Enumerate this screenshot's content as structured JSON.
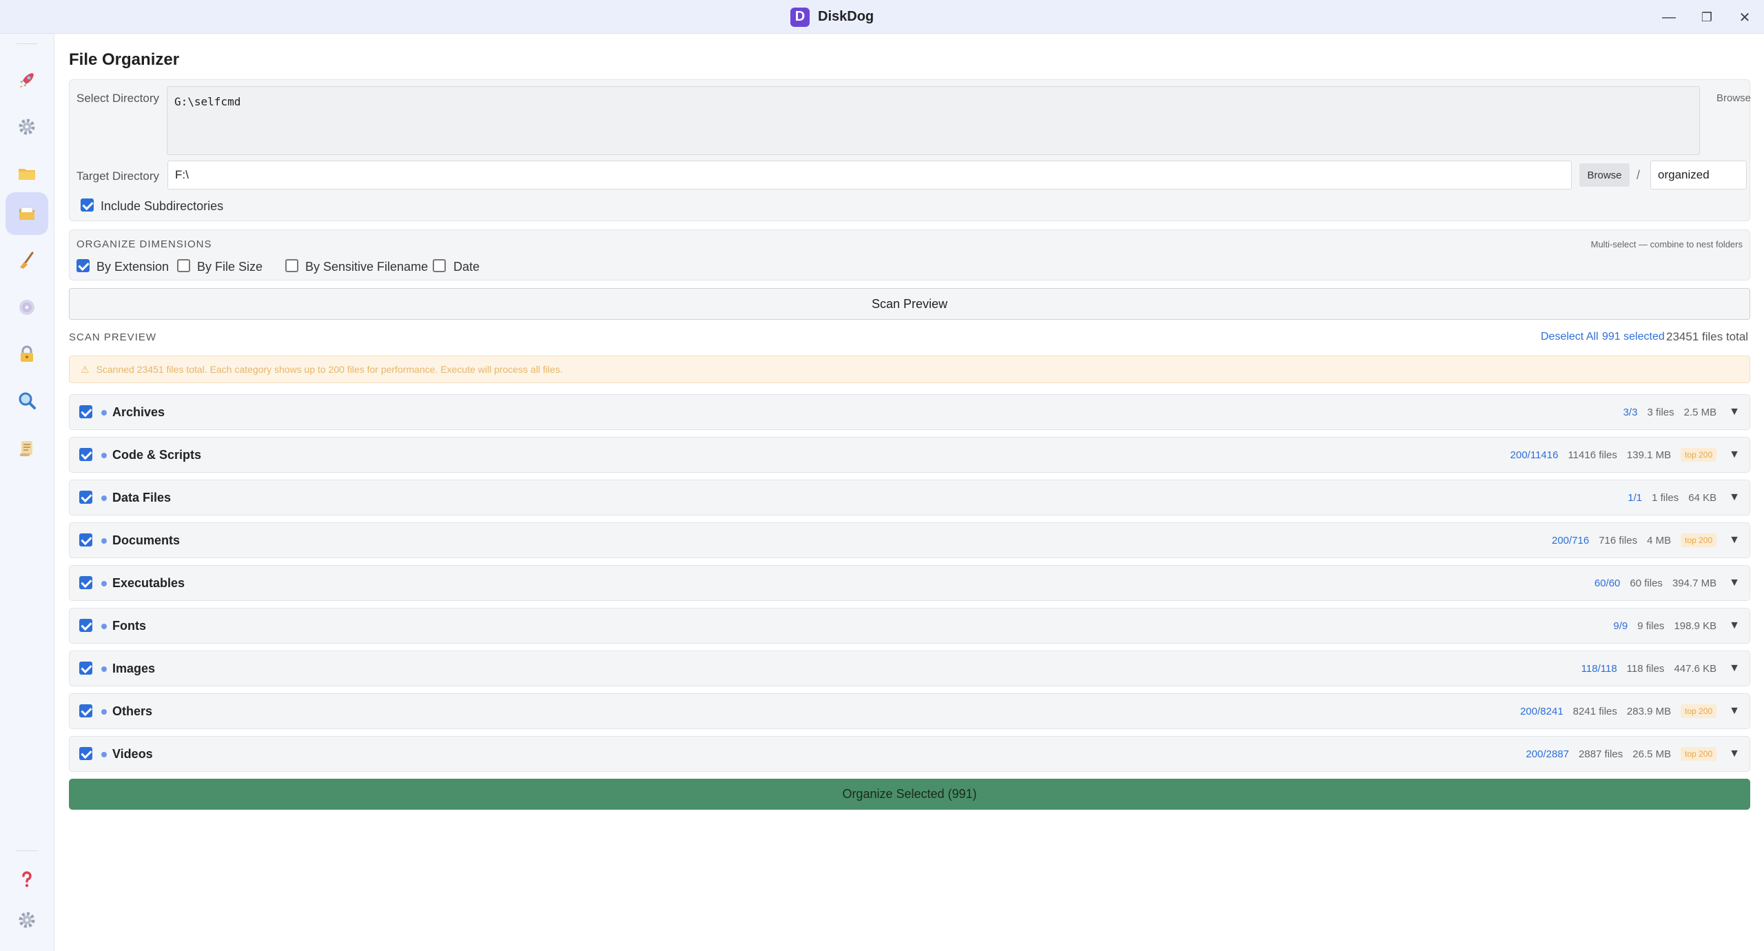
{
  "window": {
    "app_name": "DiskDog",
    "logo_letter": "D",
    "controls": {
      "minimize": "—",
      "maximize": "❐",
      "close": "✕"
    }
  },
  "sidebar": {
    "items": [
      {
        "icon": "rocket-icon",
        "active": false
      },
      {
        "icon": "gear-icon",
        "active": false
      },
      {
        "icon": "folder-icon",
        "active": false
      },
      {
        "icon": "file-organizer-icon",
        "active": true
      },
      {
        "icon": "broom-icon",
        "active": false
      },
      {
        "icon": "disc-icon",
        "active": false
      },
      {
        "icon": "lock-icon",
        "active": false
      },
      {
        "icon": "search-icon",
        "active": false
      },
      {
        "icon": "scroll-icon",
        "active": false
      }
    ],
    "bottom_items": [
      {
        "icon": "help-icon"
      },
      {
        "icon": "settings-icon"
      }
    ]
  },
  "page": {
    "title": "File Organizer"
  },
  "source": {
    "label": "Select Directory",
    "value": "G:\\selfcmd",
    "browse_label": "Browse"
  },
  "target": {
    "label": "Target Directory",
    "value": "F:\\",
    "browse_label": "Browse",
    "separator": "/",
    "subfolder": "organized"
  },
  "options": {
    "include_subdirectories": {
      "label": "Include Subdirectories",
      "checked": true
    }
  },
  "dimensions": {
    "title": "ORGANIZE DIMENSIONS",
    "hint": "Multi-select — combine to nest folders",
    "items": [
      {
        "label": "By Extension",
        "checked": true
      },
      {
        "label": "By File Size",
        "checked": false
      },
      {
        "label": "By Sensitive Filename",
        "checked": false
      },
      {
        "label": "Date",
        "checked": false
      }
    ]
  },
  "scan": {
    "button_label": "Scan Preview",
    "preview_title": "SCAN PREVIEW",
    "deselect_label": "Deselect All",
    "selected_label": "991 selected",
    "total_label": "23451 files total",
    "notice_icon": "⚠",
    "notice": "Scanned 23451 files total. Each category shows up to 200 files for performance. Execute will process all files."
  },
  "categories": [
    {
      "name": "Archives",
      "checked": true,
      "ratio": "3/3",
      "files": "3 files",
      "size": "2.5 MB",
      "badge": ""
    },
    {
      "name": "Code & Scripts",
      "checked": true,
      "ratio": "200/11416",
      "files": "11416 files",
      "size": "139.1 MB",
      "badge": "top 200"
    },
    {
      "name": "Data Files",
      "checked": true,
      "ratio": "1/1",
      "files": "1 files",
      "size": "64 KB",
      "badge": ""
    },
    {
      "name": "Documents",
      "checked": true,
      "ratio": "200/716",
      "files": "716 files",
      "size": "4 MB",
      "badge": "top 200"
    },
    {
      "name": "Executables",
      "checked": true,
      "ratio": "60/60",
      "files": "60 files",
      "size": "394.7 MB",
      "badge": ""
    },
    {
      "name": "Fonts",
      "checked": true,
      "ratio": "9/9",
      "files": "9 files",
      "size": "198.9 KB",
      "badge": ""
    },
    {
      "name": "Images",
      "checked": true,
      "ratio": "118/118",
      "files": "118 files",
      "size": "447.6 KB",
      "badge": ""
    },
    {
      "name": "Others",
      "checked": true,
      "ratio": "200/8241",
      "files": "8241 files",
      "size": "283.9 MB",
      "badge": "top 200"
    },
    {
      "name": "Videos",
      "checked": true,
      "ratio": "200/2887",
      "files": "2887 files",
      "size": "26.5 MB",
      "badge": "top 200"
    }
  ],
  "category_expand_glyph": "▼",
  "organize": {
    "button_label": "Organize Selected (991)"
  },
  "colors": {
    "accent": "#2d6fd8",
    "organize_green": "#4a8f69",
    "logo_purple": "#6c45d6",
    "notice_bg": "#fdf4e6"
  }
}
